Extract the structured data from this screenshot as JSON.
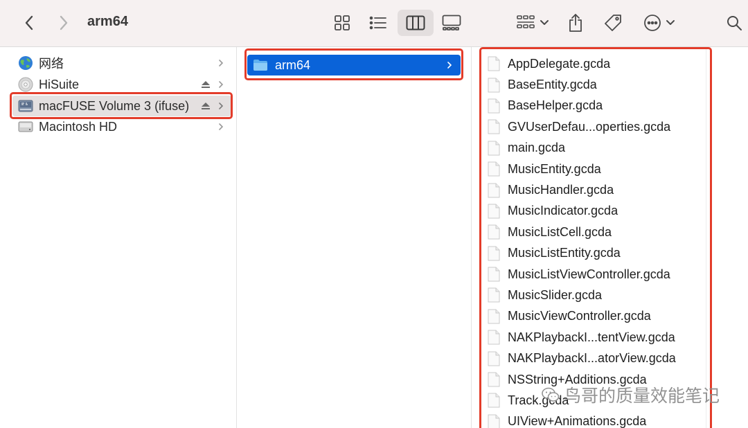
{
  "window": {
    "title": "arm64"
  },
  "toolbar": {
    "nav": {
      "back_icon": "chevron-left-icon",
      "forward_icon": "chevron-right-icon"
    },
    "views": [
      {
        "name": "icon-view",
        "icon": "grid-icon",
        "active": false
      },
      {
        "name": "list-view",
        "icon": "list-icon",
        "active": false
      },
      {
        "name": "column-view",
        "icon": "columns-icon",
        "active": true
      },
      {
        "name": "gallery-view",
        "icon": "gallery-icon",
        "active": false
      }
    ],
    "actions": [
      "group-icon",
      "share-icon",
      "tag-icon",
      "more-icon",
      "search-icon"
    ]
  },
  "sidebar": {
    "items": [
      {
        "label": "网络",
        "icon": "network-globe-icon",
        "eject": false
      },
      {
        "label": "HiSuite",
        "icon": "disc-icon",
        "eject": true
      },
      {
        "label": "macFUSE Volume 3 (ifuse)",
        "icon": "fuse-drive-icon",
        "eject": true,
        "selected": true
      },
      {
        "label": "Macintosh HD",
        "icon": "hard-drive-icon",
        "eject": false
      }
    ]
  },
  "column2": {
    "folder": {
      "label": "arm64",
      "icon": "folder-icon",
      "selected": true
    }
  },
  "column3": {
    "files": [
      "AppDelegate.gcda",
      "BaseEntity.gcda",
      "BaseHelper.gcda",
      "GVUserDefau...operties.gcda",
      "main.gcda",
      "MusicEntity.gcda",
      "MusicHandler.gcda",
      "MusicIndicator.gcda",
      "MusicListCell.gcda",
      "MusicListEntity.gcda",
      "MusicListViewController.gcda",
      "MusicSlider.gcda",
      "MusicViewController.gcda",
      "NAKPlaybackI...tentView.gcda",
      "NAKPlaybackI...atorView.gcda",
      "NSString+Additions.gcda",
      "Track.gcda",
      "UIView+Animations.gcda"
    ]
  },
  "watermark": {
    "text": "鸟哥的质量效能笔记"
  },
  "colors": {
    "selection_blue": "#0a63d9",
    "highlight_red": "#e33c2a",
    "toolbar_bg": "#f6f1f1"
  }
}
